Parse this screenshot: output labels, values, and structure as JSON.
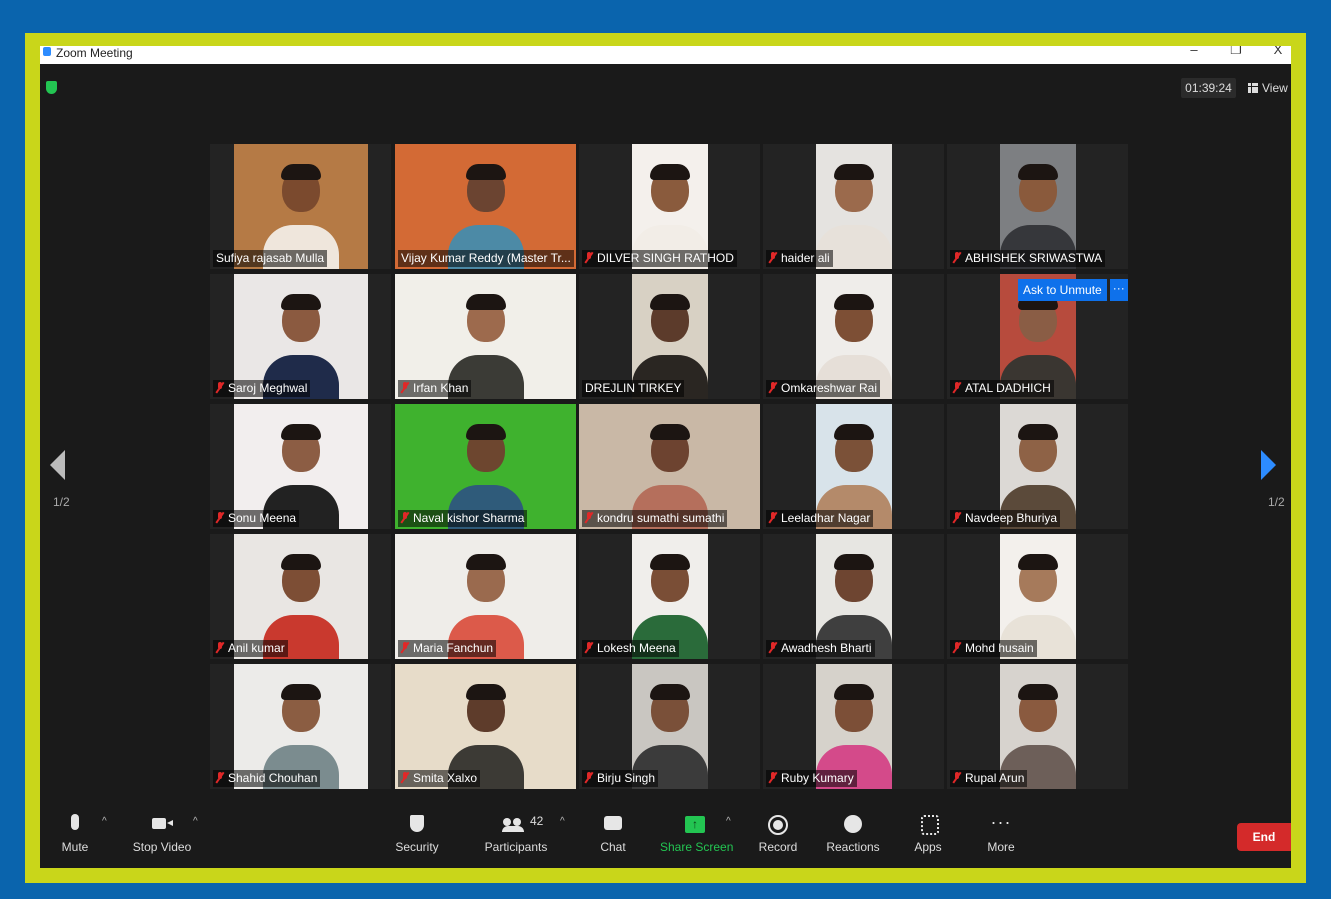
{
  "window": {
    "title": "Zoom Meeting",
    "minimize": "–",
    "restore": "❐",
    "close": "X"
  },
  "top": {
    "timer": "01:39:24",
    "view_label": "View"
  },
  "pagination": {
    "left": "1/2",
    "right": "1/2"
  },
  "ask_unmute": {
    "label": "Ask to Unmute",
    "more": "···"
  },
  "participants": [
    {
      "name": "Sufiya rajasab Mulla",
      "muted": false,
      "bg": "#b57a45",
      "shirt": "#efe6dc",
      "skin": "#7b4a2e"
    },
    {
      "name": "Vijay Kumar Reddy (Master Tr...",
      "muted": false,
      "bg": "#d36a35",
      "shirt": "#4c8aa6",
      "skin": "#6b4431",
      "active": true
    },
    {
      "name": "DILVER SINGH RATHOD",
      "muted": true,
      "bg": "#f4f0ec",
      "shirt": "#f2ede7",
      "skin": "#8a5b3d"
    },
    {
      "name": "haider ali",
      "muted": true,
      "bg": "#e5e3e0",
      "shirt": "#e7e1da",
      "skin": "#9b6a4c"
    },
    {
      "name": "ABHISHEK SRIWASTWA",
      "muted": true,
      "bg": "#7d7f82",
      "shirt": "#36373b",
      "skin": "#8a5a3c"
    },
    {
      "name": "Saroj Meghwal",
      "muted": true,
      "bg": "#eae7e6",
      "shirt": "#1f2b4a",
      "skin": "#8b5a40"
    },
    {
      "name": "Irfan Khan",
      "muted": true,
      "bg": "#f1efe9",
      "shirt": "#3b3b36",
      "skin": "#9d6a4d"
    },
    {
      "name": "DREJLIN TIRKEY",
      "muted": false,
      "bg": "#d8d1c4",
      "shirt": "#2a2622",
      "skin": "#5c3b2b"
    },
    {
      "name": "Omkareshwar Rai",
      "muted": true,
      "bg": "#efedea",
      "shirt": "#e6dfd8",
      "skin": "#7d4f35"
    },
    {
      "name": "ATAL DADHICH",
      "muted": true,
      "bg": "#b74b3d",
      "shirt": "#3a3631",
      "skin": "#8a5d45"
    },
    {
      "name": "Sonu Meena",
      "muted": true,
      "bg": "#f2eeee",
      "shirt": "#222222",
      "skin": "#8c5d44"
    },
    {
      "name": "Naval kishor Sharma",
      "muted": true,
      "bg": "#3fb22e",
      "shirt": "#2f5b7a",
      "skin": "#6d462f"
    },
    {
      "name": "kondru sumathi sumathi",
      "muted": true,
      "bg": "#c9b8a6",
      "shirt": "#b56f5c",
      "skin": "#6d4330"
    },
    {
      "name": "Leeladhar Nagar",
      "muted": true,
      "bg": "#d8e3ea",
      "shirt": "#b48a6a",
      "skin": "#7b5138"
    },
    {
      "name": "Navdeep Bhuriya",
      "muted": true,
      "bg": "#dcd9d5",
      "shirt": "#5b4a3a",
      "skin": "#8e6246"
    },
    {
      "name": "Anil kumar",
      "muted": true,
      "bg": "#e9e6e3",
      "shirt": "#c9392e",
      "skin": "#7d4e35"
    },
    {
      "name": "Maria Fanchun",
      "muted": true,
      "bg": "#efede9",
      "shirt": "#dc5a4a",
      "skin": "#9a6a4e"
    },
    {
      "name": "Lokesh Meena",
      "muted": true,
      "bg": "#f0eeeb",
      "shirt": "#2a6b3a",
      "skin": "#7a4e36"
    },
    {
      "name": "Awadhesh Bharti",
      "muted": true,
      "bg": "#e7e6e2",
      "shirt": "#3f3f3f",
      "skin": "#6e4531"
    },
    {
      "name": "Mohd husain",
      "muted": true,
      "bg": "#f3f0ec",
      "shirt": "#e8e2d8",
      "skin": "#a67a5b"
    },
    {
      "name": "Shahid Chouhan",
      "muted": true,
      "bg": "#ecebe9",
      "shirt": "#7b8c8f",
      "skin": "#8b5d42"
    },
    {
      "name": "Smita Xalxo",
      "muted": true,
      "bg": "#e7dcc9",
      "shirt": "#3c3a35",
      "skin": "#5e3c2b"
    },
    {
      "name": "Birju Singh",
      "muted": true,
      "bg": "#c9c6c1",
      "shirt": "#3b3b3b",
      "skin": "#7a5039"
    },
    {
      "name": "Ruby Kumary",
      "muted": true,
      "bg": "#d6d2cb",
      "shirt": "#d44a8a",
      "skin": "#7c4f37"
    },
    {
      "name": "Rupal Arun",
      "muted": true,
      "bg": "#d7d3ce",
      "shirt": "#6d5f59",
      "skin": "#8a5a3f"
    }
  ],
  "toolbar": {
    "mute": "Mute",
    "stop_video": "Stop Video",
    "security": "Security",
    "participants": "Participants",
    "participants_count": "42",
    "chat": "Chat",
    "share_screen": "Share Screen",
    "record": "Record",
    "reactions": "Reactions",
    "apps": "Apps",
    "more": "More",
    "end": "End",
    "share_color": "#23c552",
    "end_color": "#d42a2a"
  }
}
